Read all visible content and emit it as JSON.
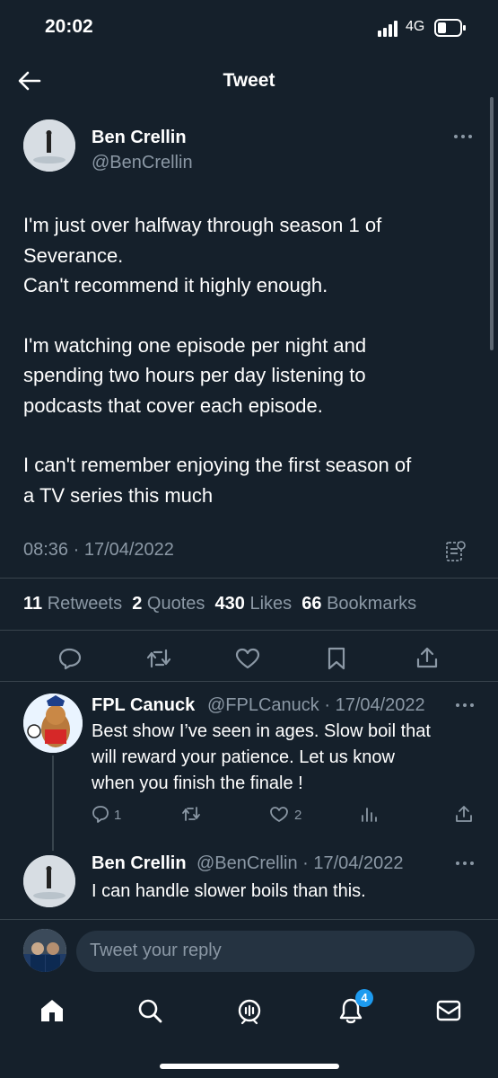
{
  "status_bar": {
    "time": "20:02",
    "network": "4G"
  },
  "header": {
    "title": "Tweet"
  },
  "tweet": {
    "author_name": "Ben Crellin",
    "author_handle": "@BenCrellin",
    "body": [
      "I'm just over halfway through season 1 of",
      "Severance.",
      "Can't recommend it highly enough.",
      "I'm watching one episode per night and",
      "spending two hours per day listening to",
      "podcasts that cover each episode.",
      "I can't remember enjoying the first season of",
      "a TV series this much"
    ],
    "timestamp": "08:36 · 17/04/2022",
    "stats": {
      "retweets_count": "11",
      "retweets_label": "Retweets",
      "quotes_count": "2",
      "quotes_label": "Quotes",
      "likes_count": "430",
      "likes_label": "Likes",
      "bookmarks_count": "66",
      "bookmarks_label": "Bookmarks"
    }
  },
  "replies": [
    {
      "name": "FPL Canuck",
      "handle_date": "@FPLCanuck · 17/04/2022",
      "text": [
        "Best show I’ve seen in ages. Slow boil that",
        "will reward your patience. Let us know",
        "when you finish the finale !"
      ],
      "reply_count": "1",
      "like_count": "2"
    },
    {
      "name": "Ben Crellin",
      "handle_date": "@BenCrellin · 17/04/2022",
      "text": [
        "I can handle slower boils than this."
      ]
    }
  ],
  "composer": {
    "placeholder": "Tweet your reply"
  },
  "nav": {
    "notifications_badge": "4"
  },
  "colors": {
    "background": "#15202b",
    "accent": "#1d9bf0",
    "muted": "#8b98a5",
    "divider": "#38444d"
  }
}
